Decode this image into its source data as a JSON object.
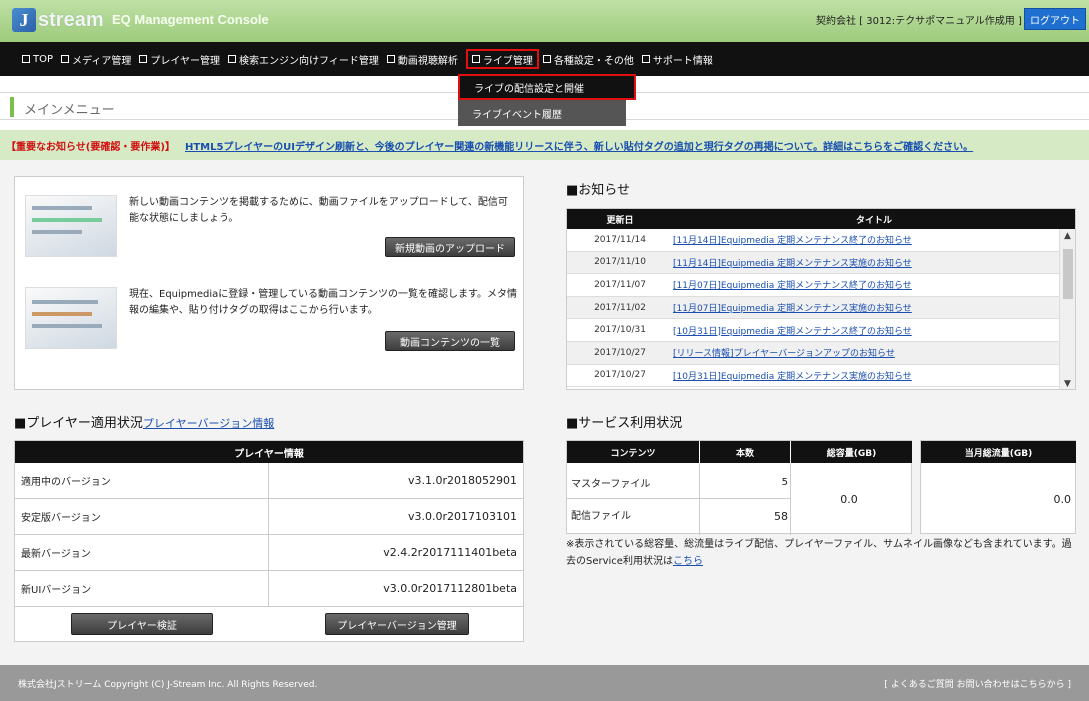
{
  "header": {
    "logo_letter": "J",
    "logo_text": "stream",
    "console_title": "EQ Management Console",
    "contract": "契約会社 [ 3012:テクサポマニュアル作成用 ]",
    "logout_label": "ログアウト"
  },
  "nav": {
    "items": [
      {
        "label": "TOP"
      },
      {
        "label": "メディア管理"
      },
      {
        "label": "プレイヤー管理"
      },
      {
        "label": "検索エンジン向けフィード管理"
      },
      {
        "label": "動画視聴解析"
      },
      {
        "label": "ライブ管理"
      },
      {
        "label": "各種設定・その他"
      },
      {
        "label": "サポート情報"
      }
    ]
  },
  "dropdown": {
    "items": [
      {
        "label": "ライブの配信設定と開催"
      },
      {
        "label": "ライブイベント履歴"
      }
    ]
  },
  "main_menu": {
    "title": "メインメニュー"
  },
  "notice": {
    "label": "【重要なお知らせ(要確認・要作業)】",
    "link": "HTML5プレイヤーのUIデザイン刷新と、今後のプレイヤー関連の新機能リリースに伴う、新しい貼付タグの追加と現行タグの再掲について。詳細はこちらをご確認ください。"
  },
  "upload": {
    "desc1": "新しい動画コンテンツを掲載するために、動画ファイルをアップロードして、配信可能な状態にしましょう。",
    "upload_button": "新規動画のアップロード",
    "desc2": "現在、Equipmediaに登録・管理している動画コンテンツの一覧を確認します。メタ情報の編集や、貼り付けタグの取得はここから行います。",
    "list_button": "動画コンテンツの一覧"
  },
  "news": {
    "title": "■お知らせ",
    "col_date": "更新日",
    "col_title": "タイトル",
    "rows": [
      {
        "date": "2017/11/14",
        "title": "[11月14日]Equipmedia 定期メンテナンス終了のお知らせ"
      },
      {
        "date": "2017/11/10",
        "title": "[11月14日]Equipmedia 定期メンテナンス実施のお知らせ"
      },
      {
        "date": "2017/11/07",
        "title": "[11月07日]Equipmedia 定期メンテナンス終了のお知らせ"
      },
      {
        "date": "2017/11/02",
        "title": "[11月07日]Equipmedia 定期メンテナンス実施のお知らせ"
      },
      {
        "date": "2017/10/31",
        "title": "[10月31日]Equipmedia 定期メンテナンス終了のお知らせ"
      },
      {
        "date": "2017/10/27",
        "title": "[リリース情報]プレイヤーバージョンアップのお知らせ"
      },
      {
        "date": "2017/10/27",
        "title": "[10月31日]Equipmedia 定期メンテナンス実施のお知らせ"
      }
    ]
  },
  "player": {
    "title": "■プレイヤー適用状況",
    "title_link": "プレイヤーバージョン情報",
    "table_head": "プレイヤー情報",
    "rows": [
      {
        "key": "適用中のバージョン",
        "value": "v3.1.0r2018052901"
      },
      {
        "key": "安定版バージョン",
        "value": "v3.0.0r2017103101"
      },
      {
        "key": "最新バージョン",
        "value": "v2.4.2r2017111401beta"
      },
      {
        "key": "新UIバージョン",
        "value": "v3.0.0r2017112801beta"
      }
    ],
    "verify_button": "プレイヤー検証",
    "version_button": "プレイヤーバージョン管理"
  },
  "service": {
    "title": "■サービス利用状況",
    "col_content": "コンテンツ",
    "col_count": "本数",
    "col_total": "総容量(GB)",
    "col_month": "当月総流量(GB)",
    "rows": [
      {
        "name": "マスターファイル",
        "count": "5"
      },
      {
        "name": "配信ファイル",
        "count": "58"
      }
    ],
    "total": "0.0",
    "month": "0.0",
    "note": "※表示されている総容量、総流量はライブ配信、プレイヤーファイル、サムネイル画像なども含まれています。過去のService利用状況は",
    "note_link": "こちら"
  },
  "footer": {
    "copyright": "株式会社Jストリーム Copyright (C) J-Stream Inc. All Rights Reserved.",
    "faq": "[ よくあるご質問 お問い合わせはこちらから ]"
  }
}
